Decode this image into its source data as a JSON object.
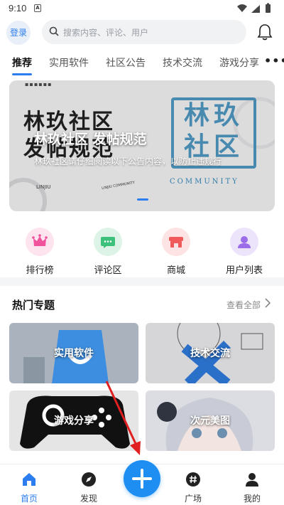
{
  "status": {
    "time": "9:10",
    "sim_label": "A"
  },
  "header": {
    "login_label": "登录",
    "search_placeholder": "搜索内容、评论、用户"
  },
  "tabs": [
    {
      "label": "推荐",
      "active": true
    },
    {
      "label": "实用软件"
    },
    {
      "label": "社区公告"
    },
    {
      "label": "技术交流"
    },
    {
      "label": "游戏分享"
    }
  ],
  "banner": {
    "art_text_line1": "林玖社区",
    "art_text_line2": "发帖规范",
    "title": "林玖社区 发帖规范",
    "subtitle": "林玖社区请仔细阅读以下公告内容，以防止违规行",
    "stamp_text": "林玖社区",
    "stamp_caption": "COMMUNITY",
    "small_left": "LINJIU",
    "small_mid": "LINJIU COMMUNITY"
  },
  "quick_links": [
    {
      "label": "排行榜",
      "icon": "crown-icon",
      "bg": "#fde4ee",
      "fg": "#f0529b"
    },
    {
      "label": "评论区",
      "icon": "chat-icon",
      "bg": "#ddf3e8",
      "fg": "#3cc07a"
    },
    {
      "label": "商城",
      "icon": "shop-icon",
      "bg": "#fde3e3",
      "fg": "#f05a5a"
    },
    {
      "label": "用户列表",
      "icon": "user-icon",
      "bg": "#ece4fb",
      "fg": "#9b6ee8"
    }
  ],
  "topics": {
    "title": "热门专题",
    "view_all": "查看全部",
    "cards": [
      {
        "label": "实用软件"
      },
      {
        "label": "技术交流"
      },
      {
        "label": "游戏分享"
      },
      {
        "label": "次元美图"
      }
    ]
  },
  "bottom_nav": [
    {
      "label": "首页",
      "icon": "home-icon",
      "active": true
    },
    {
      "label": "发现",
      "icon": "compass-icon"
    },
    {
      "label": "广场",
      "icon": "hashtag-icon"
    },
    {
      "label": "我的",
      "icon": "profile-icon"
    }
  ],
  "colors": {
    "accent": "#2c7ef0",
    "fab": "#1e8ef2",
    "annotation_arrow": "#e02020"
  }
}
